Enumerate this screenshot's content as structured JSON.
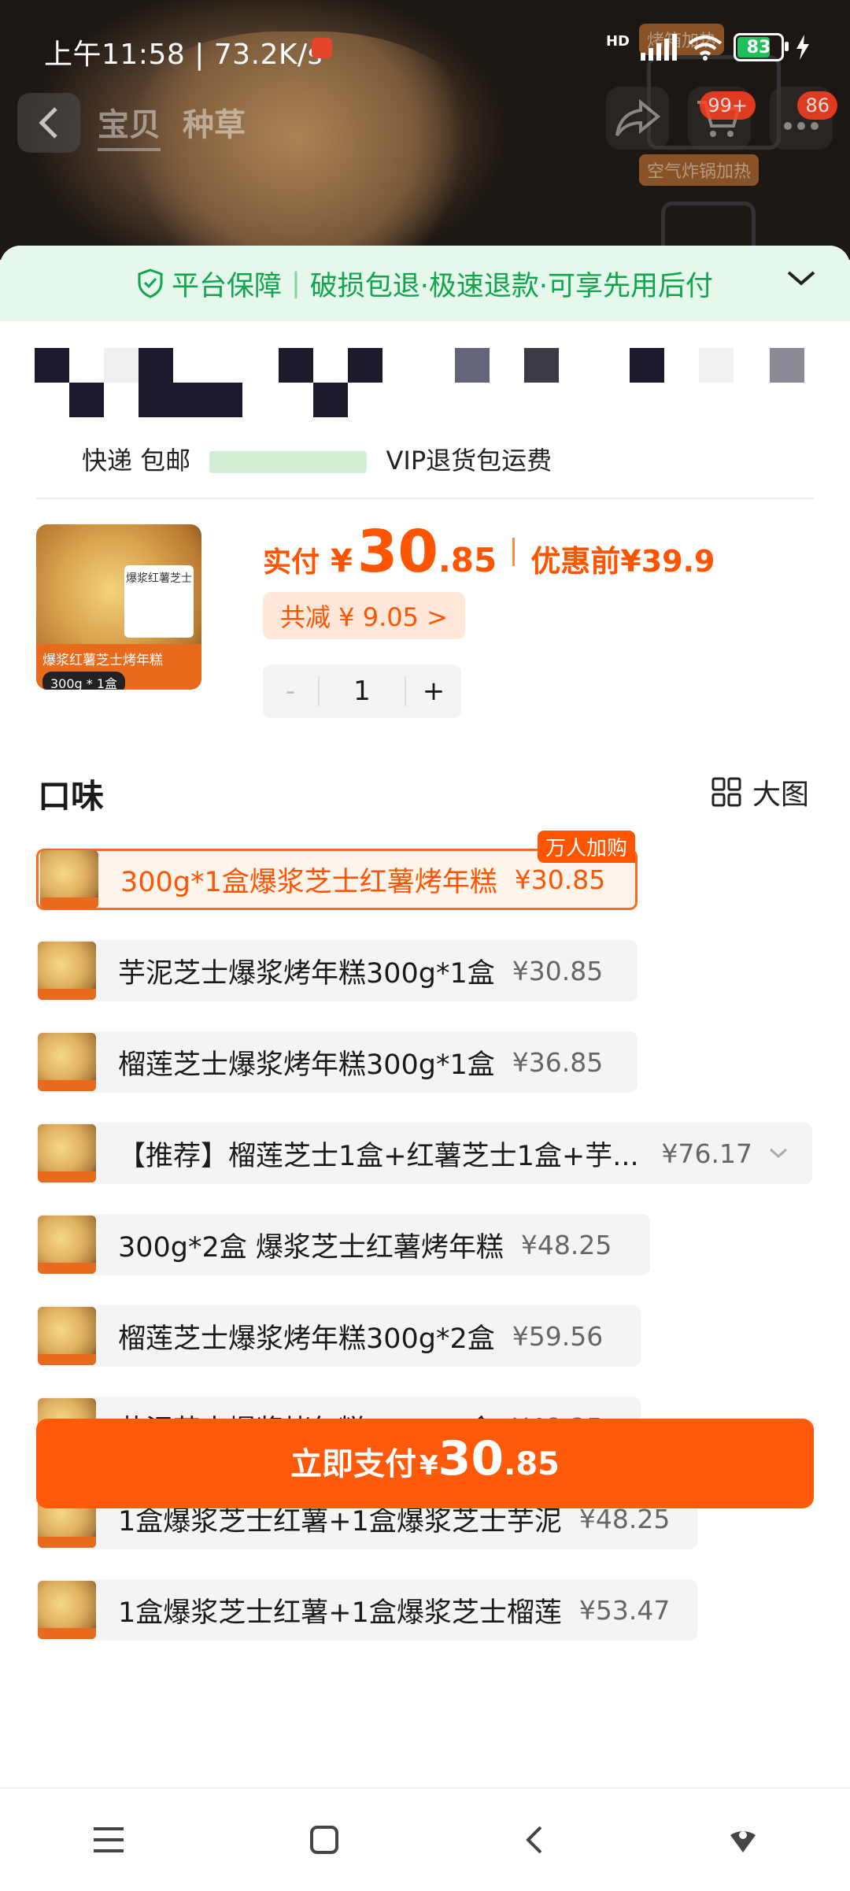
{
  "status_bar": {
    "time_text": "上午11:58 | 73.2K/s",
    "network": "HD",
    "battery": "83"
  },
  "header": {
    "tabs": [
      "宝贝",
      "种草"
    ],
    "cart_badge": "99+",
    "message_badge": "86",
    "bg_tag_1": "烤箱加热",
    "bg_tag_2": "空气炸锅加热"
  },
  "guarantee": {
    "label": "平台保障",
    "text": "破损包退·极速退款·可享先用后付"
  },
  "shipping": {
    "prefix": "快递 包邮",
    "suffix": "VIP退货包运费"
  },
  "product": {
    "thumb_title": "爆浆红薯芝士烤年糕",
    "thumb_weight": "300g * 1盒",
    "thumb_box": "爆浆红薯芝士",
    "pay_label": "实付",
    "pay_yen": "¥",
    "pay_int": "30",
    "pay_dec": ".85",
    "before_label": "优惠前",
    "before_price": "¥39.9",
    "discount": "共减 ¥ 9.05 >",
    "minus": "-",
    "qty": "1",
    "plus": "+"
  },
  "flavor": {
    "title": "口味",
    "big_view": "大图",
    "selected_badge": "万人加购",
    "options": [
      {
        "name": "300g*1盒爆浆芝士红薯烤年糕",
        "price": "¥30.85"
      },
      {
        "name": "芋泥芝士爆浆烤年糕300g*1盒",
        "price": "¥30.85"
      },
      {
        "name": "榴莲芝士爆浆烤年糕300g*1盒",
        "price": "¥36.85"
      },
      {
        "name": "【推荐】榴莲芝士1盒+红薯芝士1盒+芋...",
        "price": "¥76.17"
      },
      {
        "name": "300g*2盒 爆浆芝士红薯烤年糕",
        "price": "¥48.25"
      },
      {
        "name": "榴莲芝士爆浆烤年糕300g*2盒",
        "price": "¥59.56"
      },
      {
        "name": "芋泥芝士爆浆烤年糕300g*2盒",
        "price": "¥48.25"
      },
      {
        "name": "1盒爆浆芝士红薯+1盒爆浆芝士芋泥",
        "price": "¥48.25"
      },
      {
        "name": "1盒爆浆芝士红薯+1盒爆浆芝士榴莲",
        "price": "¥53.47"
      }
    ]
  },
  "pay_button": {
    "label": "立即支付",
    "yen": "¥",
    "int": "30",
    "dec": ".85"
  },
  "colors": {
    "accent": "#ff5500",
    "guarantee_green": "#10a44c",
    "battery_green": "#1fc05c"
  },
  "icons": [
    "back-icon",
    "share-icon",
    "cart-icon",
    "more-icon",
    "shield-check-icon",
    "chevron-down-icon",
    "grid-icon",
    "menu-icon",
    "home-icon",
    "back-nav-icon",
    "assistant-icon"
  ]
}
